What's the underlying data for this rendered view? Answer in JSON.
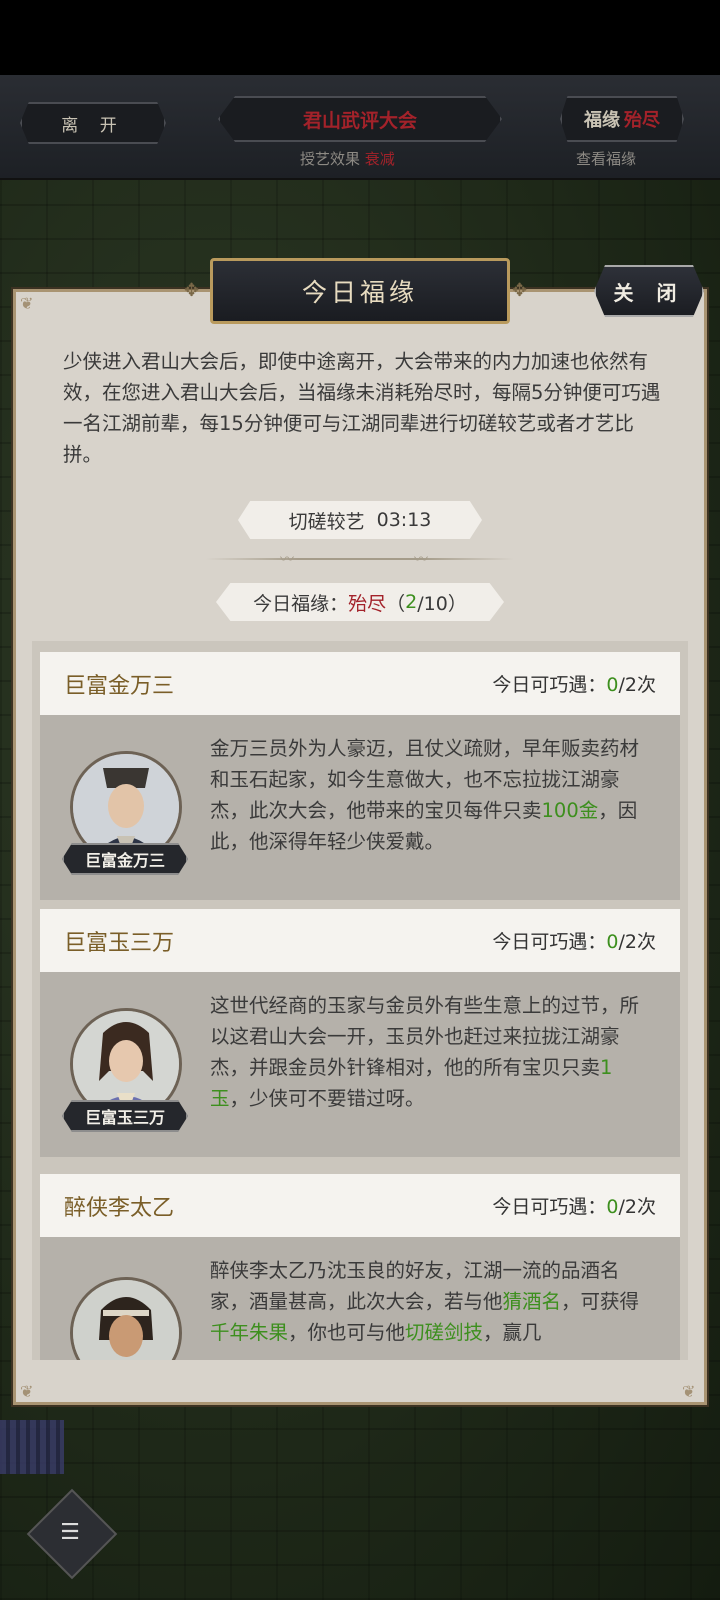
{
  "topbar": {
    "leave_label": "离 开",
    "event_title": "君山武评大会",
    "fortune_label": "福缘",
    "fortune_value": "殆尽",
    "teach_effect_label": "授艺效果",
    "teach_effect_value": "衰减",
    "view_fortune_label": "查看福缘"
  },
  "dialog": {
    "title": "今日福缘",
    "close_label": "关 闭",
    "intro": "少侠进入君山大会后，即使中途离开，大会带来的内力加速也依然有效，在您进入君山大会后，当福缘未消耗殆尽时，每隔5分钟便可巧遇一名江湖前辈，每15分钟便可与江湖同辈进行切磋较艺或者才艺比拼。",
    "spar_label": "切磋较艺",
    "spar_timer": "03:13",
    "daily_label": "今日福缘：",
    "daily_status": "殆尽",
    "daily_open": "（",
    "daily_used": "2",
    "daily_total": "/10）"
  },
  "npcs": [
    {
      "name": "巨富金万三",
      "count_label": "今日可巧遇：",
      "count_used": "0",
      "count_total": "/2次",
      "tag": "巨富金万三",
      "desc_a": "金万三员外为人豪迈，且仗义疏财，早年贩卖药材和玉石起家，如今生意做大，也不忘拉拢江湖豪杰，此次大会，他带来的宝贝每件只卖",
      "desc_hl": "100金",
      "desc_b": "，因此，他深得年轻少侠爱戴。"
    },
    {
      "name": "巨富玉三万",
      "count_label": "今日可巧遇：",
      "count_used": "0",
      "count_total": "/2次",
      "tag": "巨富玉三万",
      "desc_a": "这世代经商的玉家与金员外有些生意上的过节，所以这君山大会一开，玉员外也赶过来拉拢江湖豪杰，并跟金员外针锋相对，他的所有宝贝只卖",
      "desc_hl": "1玉",
      "desc_b": "，少侠可不要错过呀。"
    },
    {
      "name": "醉侠李太乙",
      "count_label": "今日可巧遇：",
      "count_used": "0",
      "count_total": "/2次",
      "desc_a": "醉侠李太乙乃沈玉良的好友，江湖一流的品酒名家，酒量甚高，此次大会，若与他",
      "desc_hl1": "猜酒名",
      "desc_b": "，可获得",
      "desc_hl2": "千年朱果",
      "desc_c": "，你也可与他",
      "desc_hl3": "切磋剑技",
      "desc_d": "，赢几"
    }
  ],
  "icons": {
    "chat": "chat-bubble-icon",
    "flourish": "ornament-icon"
  },
  "colors": {
    "accent_red": "#a3222a",
    "accent_green": "#3d8f1e",
    "name_gold": "#7a5e28",
    "panel_bg": "#d8d3cb"
  }
}
